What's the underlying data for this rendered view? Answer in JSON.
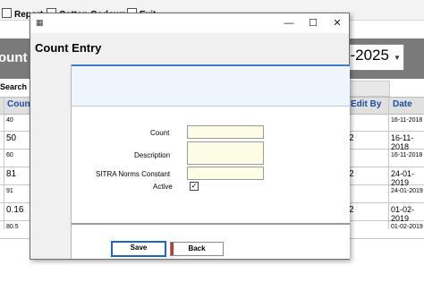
{
  "menubar": {
    "items": [
      {
        "label": "Report"
      },
      {
        "label": "Cotton Godown"
      },
      {
        "label": "Exit"
      }
    ]
  },
  "background": {
    "title_fragment": "ount",
    "year_fragment": "5-2025",
    "search_label": "Search",
    "columns": {
      "first": "Coun",
      "edit_by": "Edit By",
      "date": "Date"
    },
    "rows": [
      {
        "count": "40",
        "edit": "",
        "date": "16-11-2018"
      },
      {
        "count": "50",
        "edit": "2",
        "date": "16-11-2018"
      },
      {
        "count": "60",
        "edit": "",
        "date": "16-11-2018"
      },
      {
        "count": "81",
        "edit": "2",
        "date": "24-01-2019"
      },
      {
        "count": "91",
        "edit": "",
        "date": "24-01-2019"
      },
      {
        "count": "0.16",
        "edit": "2",
        "date": "01-02-2019"
      },
      {
        "count": "80.5",
        "edit": "",
        "date": "01-02-2019"
      }
    ]
  },
  "dialog": {
    "title": "Count Entry",
    "window_buttons": {
      "minimize": "—",
      "maximize": "☐",
      "close": "✕"
    },
    "form": {
      "count_label": "Count",
      "description_label": "Description",
      "sitra_label": "SITRA Norms Constant",
      "active_label": "Active",
      "count_value": "",
      "description_value": "",
      "sitra_value": "",
      "active_checked": "✓"
    },
    "buttons": {
      "save": "Save",
      "back": "Back"
    }
  },
  "colors": {
    "accent_blue": "#3a7cc8",
    "field_bg": "#fdfde6",
    "banner": "#7a7a7a",
    "header_text": "#1a4fa0"
  }
}
